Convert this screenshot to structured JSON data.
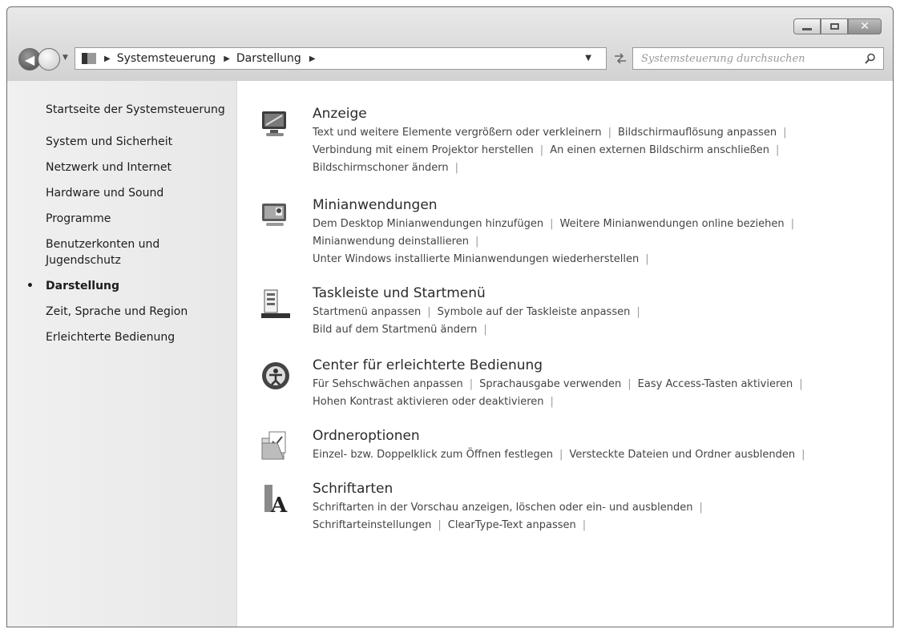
{
  "address": {
    "crumbs": [
      "Systemsteuerung",
      "Darstellung"
    ]
  },
  "search": {
    "placeholder": "Systemsteuerung durchsuchen"
  },
  "sidebar": {
    "home": "Startseite der Systemsteuerung",
    "items": [
      {
        "label": "System und Sicherheit"
      },
      {
        "label": "Netzwerk und Internet"
      },
      {
        "label": "Hardware und Sound"
      },
      {
        "label": "Programme"
      },
      {
        "label": "Benutzerkonten und Jugendschutz"
      },
      {
        "label": "Darstellung",
        "current": true
      },
      {
        "label": "Zeit, Sprache und Region"
      },
      {
        "label": "Erleichterte Bedienung"
      }
    ]
  },
  "categories": [
    {
      "title": "Anzeige",
      "icon": "monitor-icon",
      "lines": [
        [
          "Text und weitere Elemente vergrößern oder verkleinern",
          "Bildschirmauflösung anpassen"
        ],
        [
          "Verbindung mit einem Projektor herstellen",
          "An einen externen Bildschirm anschließen"
        ],
        [
          "Bildschirmschoner ändern"
        ]
      ]
    },
    {
      "title": "Minianwendungen",
      "icon": "gadgets-icon",
      "lines": [
        [
          "Dem Desktop Minianwendungen hinzufügen",
          "Weitere Minianwendungen online beziehen"
        ],
        [
          "Minianwendung deinstallieren"
        ],
        [
          "Unter Windows installierte Minianwendungen wiederherstellen"
        ]
      ]
    },
    {
      "title": "Taskleiste und Startmenü",
      "icon": "taskbar-icon",
      "lines": [
        [
          "Startmenü anpassen",
          "Symbole auf der Taskleiste anpassen"
        ],
        [
          "Bild auf dem Startmenü ändern"
        ]
      ]
    },
    {
      "title": "Center für erleichterte Bedienung",
      "icon": "ease-of-access-icon",
      "lines": [
        [
          "Für Sehschwächen anpassen",
          "Sprachausgabe verwenden",
          "Easy Access-Tasten aktivieren"
        ],
        [
          "Hohen Kontrast aktivieren oder deaktivieren"
        ]
      ]
    },
    {
      "title": "Ordneroptionen",
      "icon": "folder-options-icon",
      "lines": [
        [
          "Einzel- bzw. Doppelklick zum Öffnen festlegen",
          "Versteckte Dateien und Ordner ausblenden"
        ]
      ]
    },
    {
      "title": "Schriftarten",
      "icon": "fonts-icon",
      "lines": [
        [
          "Schriftarten in der Vorschau anzeigen, löschen oder ein- und ausblenden"
        ],
        [
          "Schriftarteinstellungen",
          "ClearType-Text anpassen"
        ]
      ]
    }
  ]
}
